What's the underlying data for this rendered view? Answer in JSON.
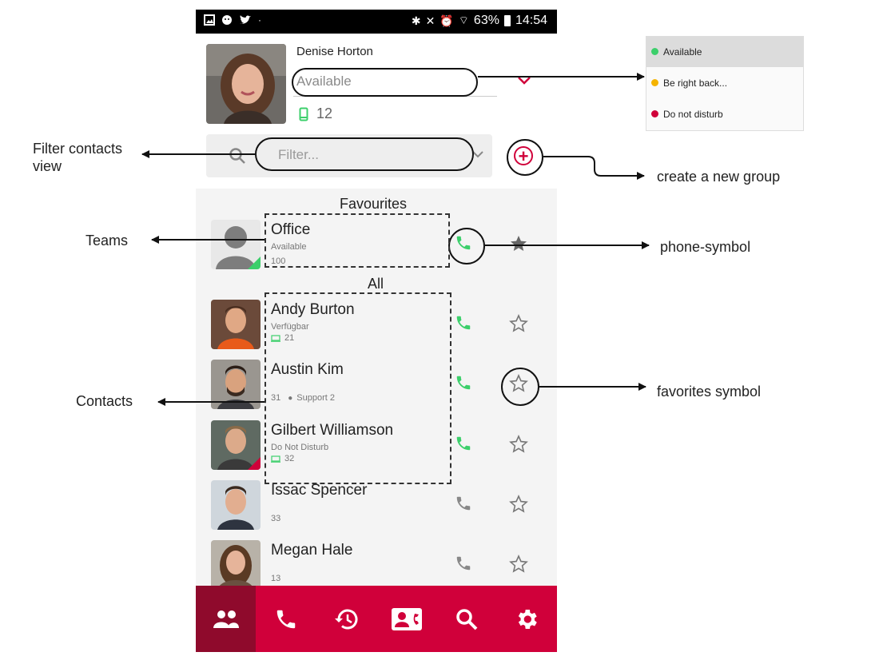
{
  "status_bar": {
    "battery_pct": "63%",
    "time": "14:54"
  },
  "profile": {
    "name": "Denise Horton",
    "status": "Available",
    "extension": "12"
  },
  "filter": {
    "placeholder": "Filter..."
  },
  "sections": {
    "favourites": "Favourites",
    "all": "All"
  },
  "favourites": [
    {
      "name": "Office",
      "status": "Available",
      "ext": "100"
    }
  ],
  "contacts": [
    {
      "name": "Andy Burton",
      "status": "Verfügbar",
      "ext": "21"
    },
    {
      "name": "Austin Kim",
      "status": "",
      "ext": "31",
      "location": "Support 2"
    },
    {
      "name": "Gilbert Williamson",
      "status": "Do Not Disturb",
      "ext": "32"
    },
    {
      "name": "Issac Spencer",
      "status": "",
      "ext": "33"
    },
    {
      "name": "Megan Hale",
      "status": "",
      "ext": "13"
    }
  ],
  "status_dropdown": {
    "options": [
      "Available",
      "Be right back...",
      "Do not disturb"
    ],
    "selected": "Available"
  },
  "annotations": {
    "filter": "Filter contacts\nview",
    "teams": "Teams",
    "contacts": "Contacts",
    "create_group": "create a new group",
    "phone_symbol": "phone-symbol",
    "favorites_symbol": "favorites symbol"
  },
  "colors": {
    "brand": "#d0003a",
    "brand_dark": "#8f0a2c",
    "available": "#3ccf6b",
    "away": "#f5b400",
    "dnd": "#d0003a"
  },
  "icons": {
    "tabs": [
      "people-icon",
      "phone-icon",
      "history-icon",
      "contact-card-icon",
      "search-icon",
      "settings-icon"
    ]
  }
}
